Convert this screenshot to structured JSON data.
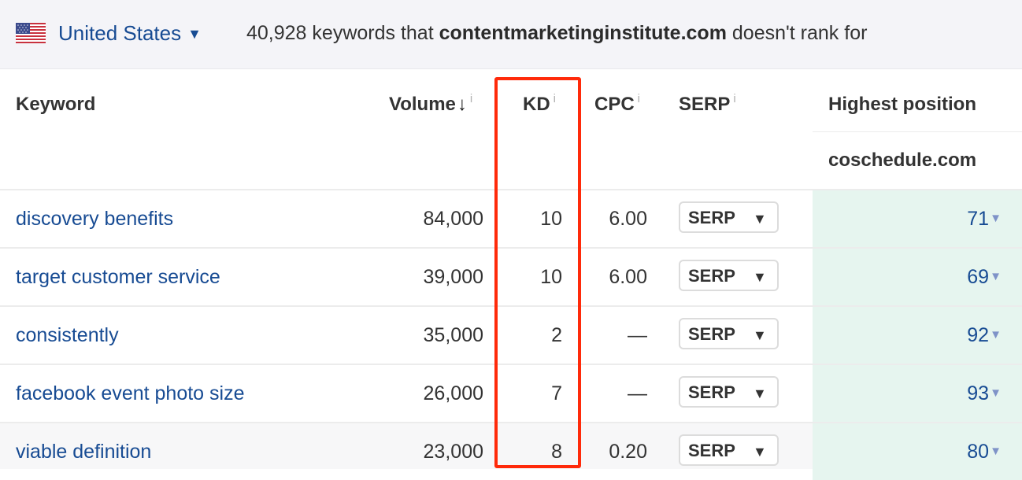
{
  "topbar": {
    "flag_icon": "us-flag-icon",
    "country": "United States",
    "country_caret": "▼",
    "summary_count": "40,928 keywords that",
    "summary_domain": "contentmarketinginstitute.com",
    "summary_tail": "doesn't rank for"
  },
  "table": {
    "headers": {
      "keyword": "Keyword",
      "volume": "Volume",
      "volume_sort": "↓",
      "kd": "KD",
      "cpc": "CPC",
      "serp": "SERP",
      "highest_position": "Highest position",
      "competitor": "coschedule.com",
      "info": "i"
    },
    "serp_button_label": "SERP",
    "serp_caret": "▼",
    "position_caret": "▼",
    "rows": [
      {
        "keyword": "discovery benefits",
        "volume": "84,000",
        "kd": "10",
        "cpc": "6.00",
        "position": "71"
      },
      {
        "keyword": "target customer service",
        "volume": "39,000",
        "kd": "10",
        "cpc": "6.00",
        "position": "69"
      },
      {
        "keyword": "consistently",
        "volume": "35,000",
        "kd": "2",
        "cpc": "—",
        "position": "92"
      },
      {
        "keyword": "facebook event photo size",
        "volume": "26,000",
        "kd": "7",
        "cpc": "—",
        "position": "93"
      },
      {
        "keyword": "viable definition",
        "volume": "23,000",
        "kd": "8",
        "cpc": "0.20",
        "position": "80"
      }
    ]
  },
  "annotation": {
    "highlight_column": "KD",
    "highlight_color": "#ff2a0a"
  },
  "colors": {
    "link": "#174b93",
    "highlight_bg": "#e6f5ef",
    "topbar_bg": "#f4f4f8"
  }
}
